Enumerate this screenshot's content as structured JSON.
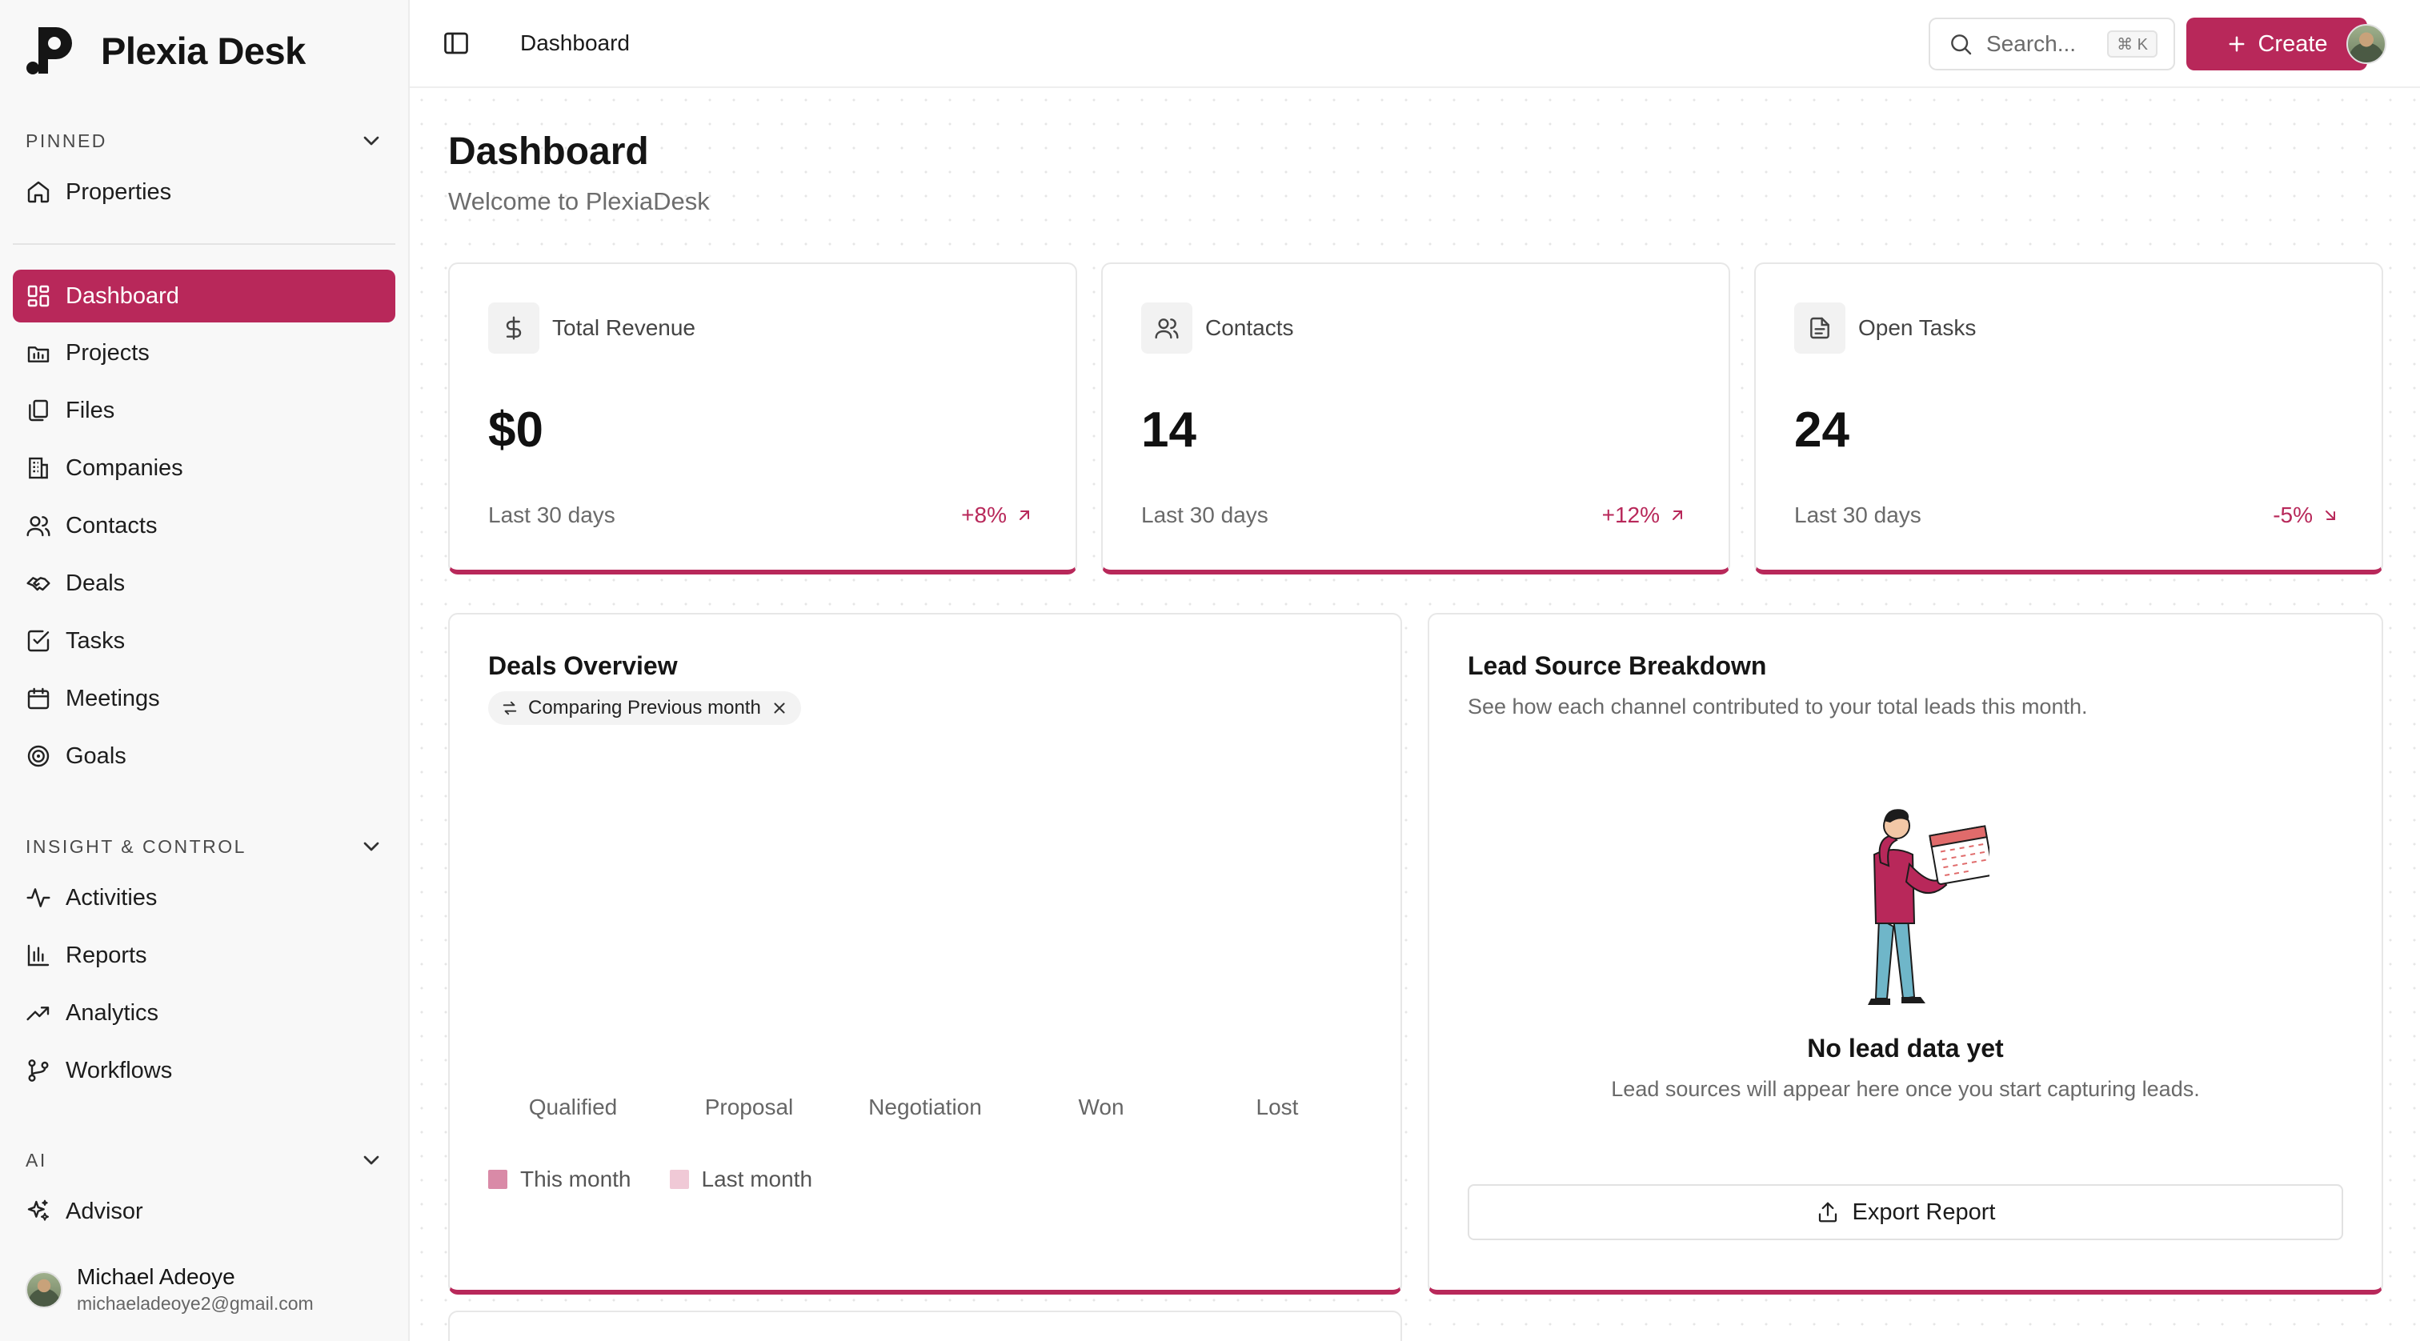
{
  "brand": {
    "name": "Plexia Desk"
  },
  "sidebar": {
    "pinned_title": "PINNED",
    "pinned_items": [
      {
        "label": "Properties",
        "icon": "home-icon"
      }
    ],
    "main_items": [
      {
        "label": "Dashboard",
        "icon": "dashboard-icon",
        "active": true
      },
      {
        "label": "Projects",
        "icon": "projects-icon"
      },
      {
        "label": "Files",
        "icon": "files-icon"
      },
      {
        "label": "Companies",
        "icon": "building-icon"
      },
      {
        "label": "Contacts",
        "icon": "users-icon"
      },
      {
        "label": "Deals",
        "icon": "handshake-icon"
      },
      {
        "label": "Tasks",
        "icon": "checkbox-icon"
      },
      {
        "label": "Meetings",
        "icon": "calendar-icon"
      },
      {
        "label": "Goals",
        "icon": "target-icon"
      }
    ],
    "insight_title": "INSIGHT & CONTROL",
    "insight_items": [
      {
        "label": "Activities",
        "icon": "activity-icon"
      },
      {
        "label": "Reports",
        "icon": "bar-chart-icon"
      },
      {
        "label": "Analytics",
        "icon": "trending-up-icon"
      },
      {
        "label": "Workflows",
        "icon": "git-branch-icon"
      }
    ],
    "ai_title": "AI",
    "ai_items": [
      {
        "label": "Advisor",
        "icon": "sparkles-icon"
      }
    ],
    "user": {
      "name": "Michael Adeoye",
      "email": "michaeladeoye2@gmail.com"
    }
  },
  "topbar": {
    "breadcrumb": "Dashboard",
    "search_placeholder": "Search...",
    "search_shortcut": "⌘ K",
    "create_label": "Create"
  },
  "page": {
    "title": "Dashboard",
    "subtitle": "Welcome to PlexiaDesk"
  },
  "stats": [
    {
      "label": "Total Revenue",
      "value": "$0",
      "period": "Last 30 days",
      "change": "+8%",
      "direction": "up",
      "icon": "dollar-icon"
    },
    {
      "label": "Contacts",
      "value": "14",
      "period": "Last 30 days",
      "change": "+12%",
      "direction": "up",
      "icon": "users-icon"
    },
    {
      "label": "Open Tasks",
      "value": "24",
      "period": "Last 30 days",
      "change": "-5%",
      "direction": "down",
      "icon": "file-text-icon"
    }
  ],
  "deals": {
    "title": "Deals Overview",
    "chip": "Comparing Previous month",
    "chart_data": {
      "type": "bar",
      "categories": [
        "Qualified",
        "Proposal",
        "Negotiation",
        "Won",
        "Lost"
      ],
      "series": [
        {
          "name": "This month",
          "values": [
            0,
            0,
            0,
            0,
            0
          ],
          "color": "#d98aa7"
        },
        {
          "name": "Last month",
          "values": [
            0,
            0,
            0,
            0,
            0
          ],
          "color": "#f0c9d6"
        }
      ],
      "title": "Deals Overview",
      "legend": "bottom-left"
    }
  },
  "lead": {
    "title": "Lead Source Breakdown",
    "subtitle": "See how each channel contributed to your total leads this month.",
    "empty_title": "No lead data yet",
    "empty_subtitle": "Lead sources will appear here once you start capturing leads.",
    "export_label": "Export Report"
  },
  "colors": {
    "accent": "#b8285a",
    "this_month": "#d98aa7",
    "last_month": "#f0c9d6"
  }
}
